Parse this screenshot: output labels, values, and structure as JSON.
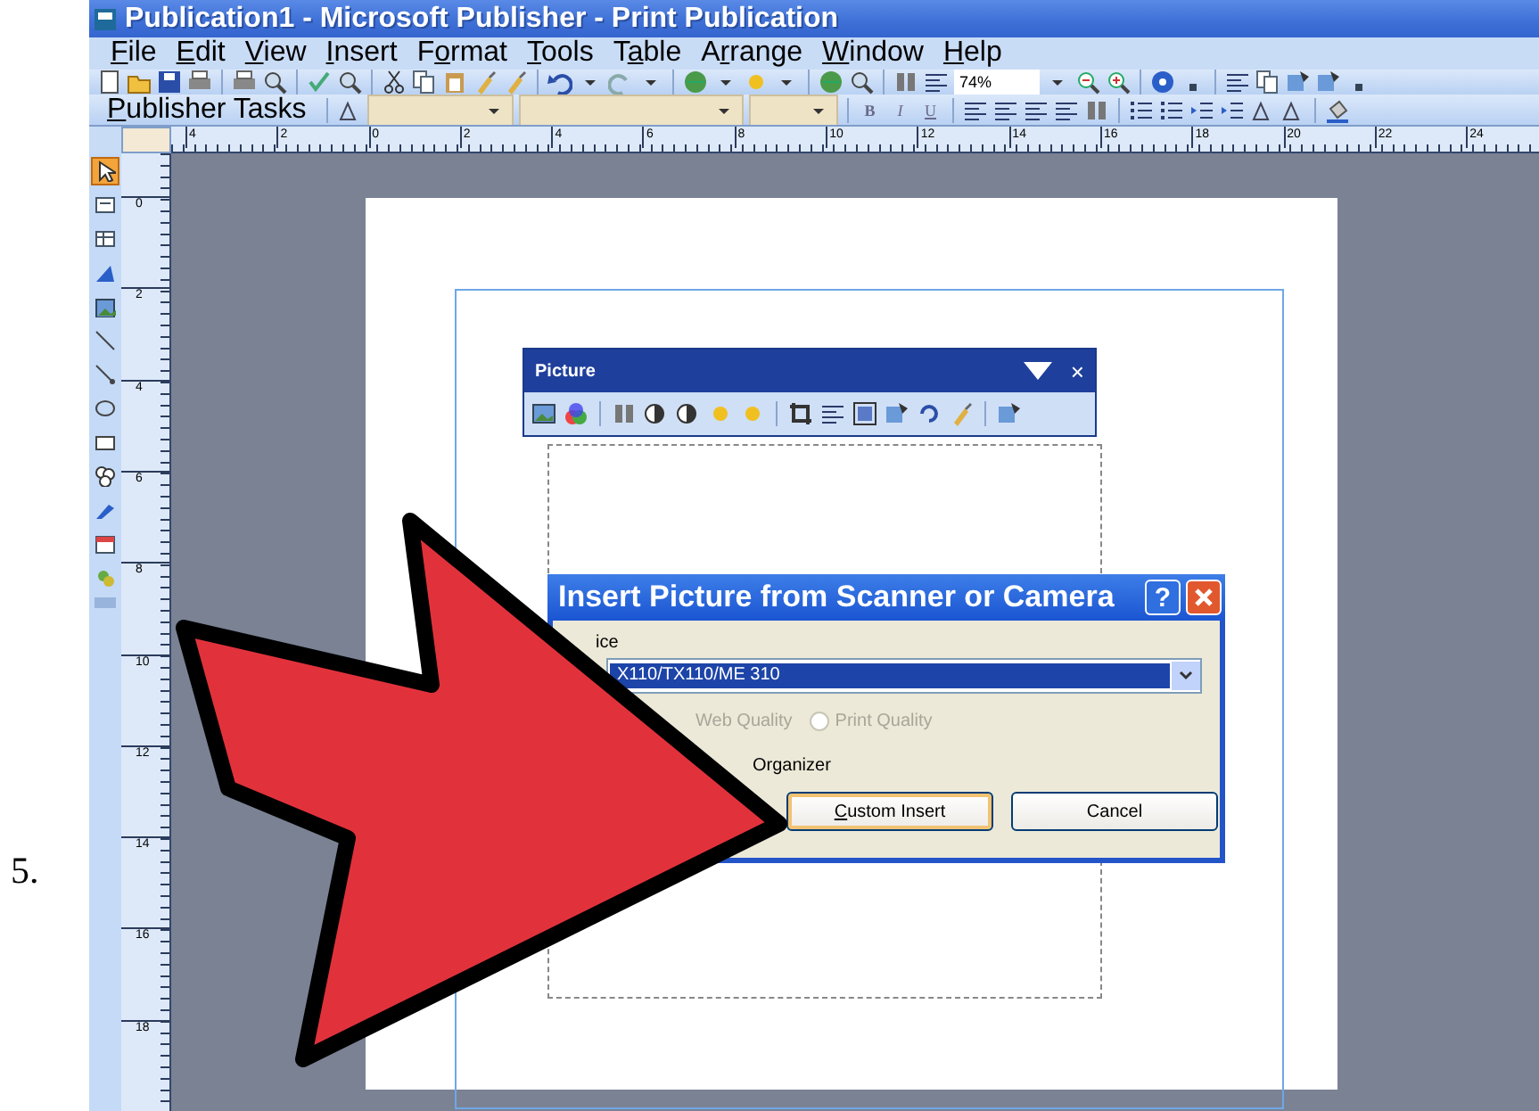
{
  "step": "5.",
  "window": {
    "title": "Publication1 - Microsoft Publisher - Print Publication"
  },
  "menu": [
    {
      "key": "F",
      "rest": "ile"
    },
    {
      "key": "E",
      "rest": "dit"
    },
    {
      "key": "V",
      "rest": "iew"
    },
    {
      "key": "I",
      "rest": "nsert"
    },
    {
      "lead": "F",
      "key": "o",
      "rest": "rmat"
    },
    {
      "key": "T",
      "rest": "ools"
    },
    {
      "lead": "T",
      "key": "a",
      "rest": "ble"
    },
    {
      "lead": "A",
      "key": "r",
      "rest": "range"
    },
    {
      "key": "W",
      "rest": "indow"
    },
    {
      "key": "H",
      "rest": "elp"
    }
  ],
  "standard_toolbar": {
    "zoom": "74%"
  },
  "formatting_toolbar": {
    "tasks": {
      "key": "P",
      "rest": "ublisher Tasks"
    },
    "style_buttons": [
      "B",
      "I",
      "U"
    ]
  },
  "horizontal_ruler": [
    "4",
    "2",
    "0",
    "2",
    "4",
    "6",
    "8",
    "10",
    "12",
    "14",
    "16",
    "18",
    "20",
    "22",
    "24"
  ],
  "vertical_ruler": [
    "0",
    "2",
    "4",
    "6",
    "8",
    "10",
    "12",
    "14",
    "16",
    "18"
  ],
  "toolbox": [
    {
      "kind": "pointer",
      "selected": true
    },
    {
      "kind": "textbox",
      "selected": false
    },
    {
      "kind": "table",
      "selected": false
    },
    {
      "kind": "wordart",
      "selected": false
    },
    {
      "kind": "picture",
      "selected": false
    },
    {
      "kind": "line",
      "selected": false
    },
    {
      "kind": "arrow",
      "selected": false
    },
    {
      "kind": "oval",
      "selected": false
    },
    {
      "kind": "rectangle",
      "selected": false
    },
    {
      "kind": "shapes",
      "selected": false
    },
    {
      "kind": "pen",
      "selected": false
    },
    {
      "kind": "calendar",
      "selected": false
    },
    {
      "kind": "clipart",
      "selected": false
    }
  ],
  "picture_toolbar": {
    "title": "Picture",
    "close": "×"
  },
  "dialog": {
    "title": "Insert Picture from Scanner or Camera",
    "help": "?",
    "device_label": "ice",
    "device": "X110/TX110/ME 310",
    "quality_options": [
      {
        "label": "Web Quality",
        "disabled": true
      },
      {
        "label": "Print Quality",
        "disabled": true,
        "selected": false
      }
    ],
    "organizer_label": "Organizer",
    "buttons": [
      {
        "key": "C",
        "rest": "ustom Insert",
        "focused": true
      },
      {
        "rest": "Cancel",
        "focused": false
      }
    ]
  }
}
